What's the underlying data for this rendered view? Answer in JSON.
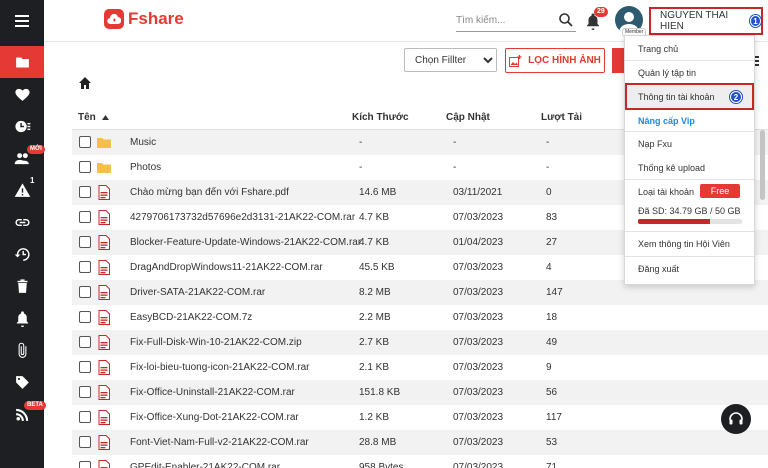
{
  "brand": {
    "name": "Fshare",
    "color": "#e53935"
  },
  "header": {
    "search_placeholder": "Tìm kiếm...",
    "notification_count": "29",
    "avatar_label": "Member",
    "user_name": "NGUYEN THAI HIEN",
    "step1": "1"
  },
  "sidebar": {
    "items": [
      {
        "icon": "folder-icon",
        "active": true
      },
      {
        "icon": "heart-icon"
      },
      {
        "icon": "recent-icon"
      },
      {
        "icon": "users-icon",
        "badge": "MỚI"
      },
      {
        "icon": "warning-icon",
        "sup": "1"
      },
      {
        "icon": "link-icon"
      },
      {
        "icon": "history-icon"
      },
      {
        "icon": "trash-icon"
      },
      {
        "icon": "bell-icon"
      },
      {
        "icon": "attachment-icon"
      },
      {
        "icon": "tag-icon"
      },
      {
        "icon": "rss-icon",
        "badge": "BETA"
      }
    ]
  },
  "toolbar": {
    "filter_selected": "Chọn Fillter",
    "filter_button": "LỌC HÌNH ẢNH"
  },
  "table": {
    "headers": {
      "name": "Tên",
      "size": "Kích Thước",
      "updated": "Cập Nhật",
      "downloads": "Lượt Tải"
    },
    "rows": [
      {
        "type": "folder",
        "name": "Music",
        "size": "-",
        "date": "-",
        "downloads": "-"
      },
      {
        "type": "folder",
        "name": "Photos",
        "size": "-",
        "date": "-",
        "downloads": "-"
      },
      {
        "type": "file",
        "name": "Chào mừng bạn đến với Fshare.pdf",
        "size": "14.6 MB",
        "date": "03/11/2021",
        "downloads": "0"
      },
      {
        "type": "file",
        "name": "4279706173732d57696e2d3131-21AK22-COM.rar",
        "size": "4.7 KB",
        "date": "07/03/2023",
        "downloads": "83"
      },
      {
        "type": "file",
        "name": "Blocker-Feature-Update-Windows-21AK22-COM.rar",
        "size": "4.7 KB",
        "date": "01/04/2023",
        "downloads": "27"
      },
      {
        "type": "file",
        "name": "DragAndDropWindows11-21AK22-COM.rar",
        "size": "45.5 KB",
        "date": "07/03/2023",
        "downloads": "4"
      },
      {
        "type": "file",
        "name": "Driver-SATA-21AK22-COM.rar",
        "size": "8.2 MB",
        "date": "07/03/2023",
        "downloads": "147"
      },
      {
        "type": "file",
        "name": "EasyBCD-21AK22-COM.7z",
        "size": "2.2 MB",
        "date": "07/03/2023",
        "downloads": "18"
      },
      {
        "type": "file",
        "name": "Fix-Full-Disk-Win-10-21AK22-COM.zip",
        "size": "2.7 KB",
        "date": "07/03/2023",
        "downloads": "49"
      },
      {
        "type": "file",
        "name": "Fix-loi-bieu-tuong-icon-21AK22-COM.rar",
        "size": "2.1 KB",
        "date": "07/03/2023",
        "downloads": "9"
      },
      {
        "type": "file",
        "name": "Fix-Office-Uninstall-21AK22-COM.rar",
        "size": "151.8 KB",
        "date": "07/03/2023",
        "downloads": "56"
      },
      {
        "type": "file",
        "name": "Fix-Office-Xung-Dot-21AK22-COM.rar",
        "size": "1.2 KB",
        "date": "07/03/2023",
        "downloads": "117"
      },
      {
        "type": "file",
        "name": "Font-Viet-Nam-Full-v2-21AK22-COM.rar",
        "size": "28.8 MB",
        "date": "07/03/2023",
        "downloads": "53"
      },
      {
        "type": "file",
        "name": "GPEdit-Enabler-21AK22-COM.rar",
        "size": "958 Bytes",
        "date": "07/03/2023",
        "downloads": "71"
      }
    ]
  },
  "user_menu": {
    "home": "Trang chủ",
    "file_manager": "Quản lý tập tin",
    "account_info": "Thông tin tài khoản",
    "step2": "2",
    "upgrade_vip": "Nâng cấp Vip",
    "topup": "Nạp Fxu",
    "upload_stats": "Thống kê upload",
    "account_type_label": "Loại tài khoản",
    "account_type": "Free",
    "quota_text": "Đã SD: 34.79 GB / 50 GB",
    "quota_fraction": 0.6958,
    "member_info": "Xem thông tin Hội Viên",
    "logout": "Đăng xuất"
  }
}
